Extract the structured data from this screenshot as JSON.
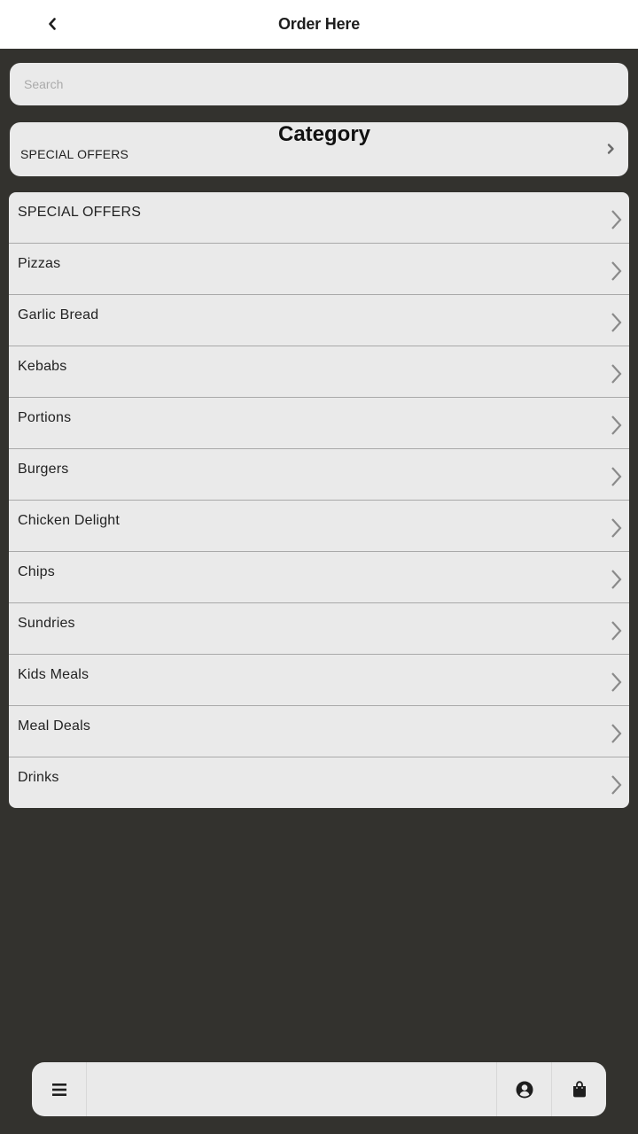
{
  "header": {
    "title": "Order Here",
    "back_icon": "chevron-left-icon"
  },
  "search": {
    "placeholder": "Search",
    "value": ""
  },
  "category": {
    "title": "Category",
    "selected": "SPECIAL OFFERS",
    "icon": "chevron-right-icon"
  },
  "categories": [
    {
      "label": "SPECIAL OFFERS"
    },
    {
      "label": "Pizzas"
    },
    {
      "label": "Garlic Bread"
    },
    {
      "label": "Kebabs"
    },
    {
      "label": "Portions"
    },
    {
      "label": "Burgers"
    },
    {
      "label": "Chicken Delight"
    },
    {
      "label": "Chips"
    },
    {
      "label": "Sundries"
    },
    {
      "label": "Kids Meals"
    },
    {
      "label": "Meal Deals"
    },
    {
      "label": "Drinks"
    }
  ],
  "bottom_bar": {
    "menu_icon": "hamburger-menu-icon",
    "account_icon": "user-circle-icon",
    "cart_icon": "shopping-bag-icon"
  },
  "colors": {
    "background": "#33322e",
    "surface": "#eaeaea",
    "header": "#ffffff",
    "text": "#222222",
    "chevron": "#8a8a8a"
  }
}
